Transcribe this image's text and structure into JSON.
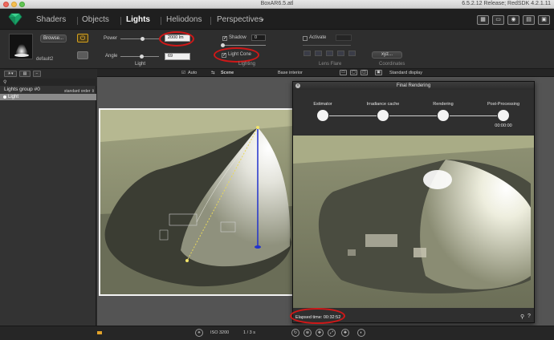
{
  "window": {
    "title": "BoxAR6.5.atl",
    "release": "6.5.2.12 Release; RedSDK 4.2.1.11"
  },
  "tabs": [
    {
      "label": "Shaders"
    },
    {
      "label": "Objects"
    },
    {
      "label": "Lights"
    },
    {
      "label": "Heliodons"
    },
    {
      "label": "Perspectives"
    }
  ],
  "active_tab": "Lights",
  "props": {
    "preview_name": "default2",
    "browse_label": "Browse...",
    "power_label": "Power",
    "power_value": "2000 lm",
    "angle_label": "Angle",
    "angle_value": "69",
    "light_label": "Light",
    "shadow_label": "Shadow",
    "shadow_value": "0",
    "light_cone_label": "Light Cone",
    "lighting_label": "Lighting",
    "activate_label": "Activate",
    "lens_flare_label": "Lens Flare",
    "coords_value": "xyz...",
    "coordinates_label": "Coordinates"
  },
  "toolbar2": {
    "auto_label": "Auto",
    "scene_label": "Scene",
    "base_interior_label": "Base interior",
    "standard_display_label": "Standard display"
  },
  "left_panel": {
    "sort_label": "standard order",
    "group_label": "Lights group #0",
    "item_label": "Light"
  },
  "render_window": {
    "title": "Final Rendering",
    "steps": [
      {
        "label": "Estimator"
      },
      {
        "label": "Irradiance cache"
      },
      {
        "label": "Rendering"
      },
      {
        "label": "Post-Processing"
      }
    ],
    "post_time": "00:00:00",
    "elapsed": "Elapsed time: 00:32:52"
  },
  "bottom_bar": {
    "iso": "ISO 3200",
    "shutter": "1 / 3 s"
  },
  "colors": {
    "annotation_red": "#d01818",
    "power_accent": "#d6a11e",
    "selection": "#8a8a8a"
  }
}
